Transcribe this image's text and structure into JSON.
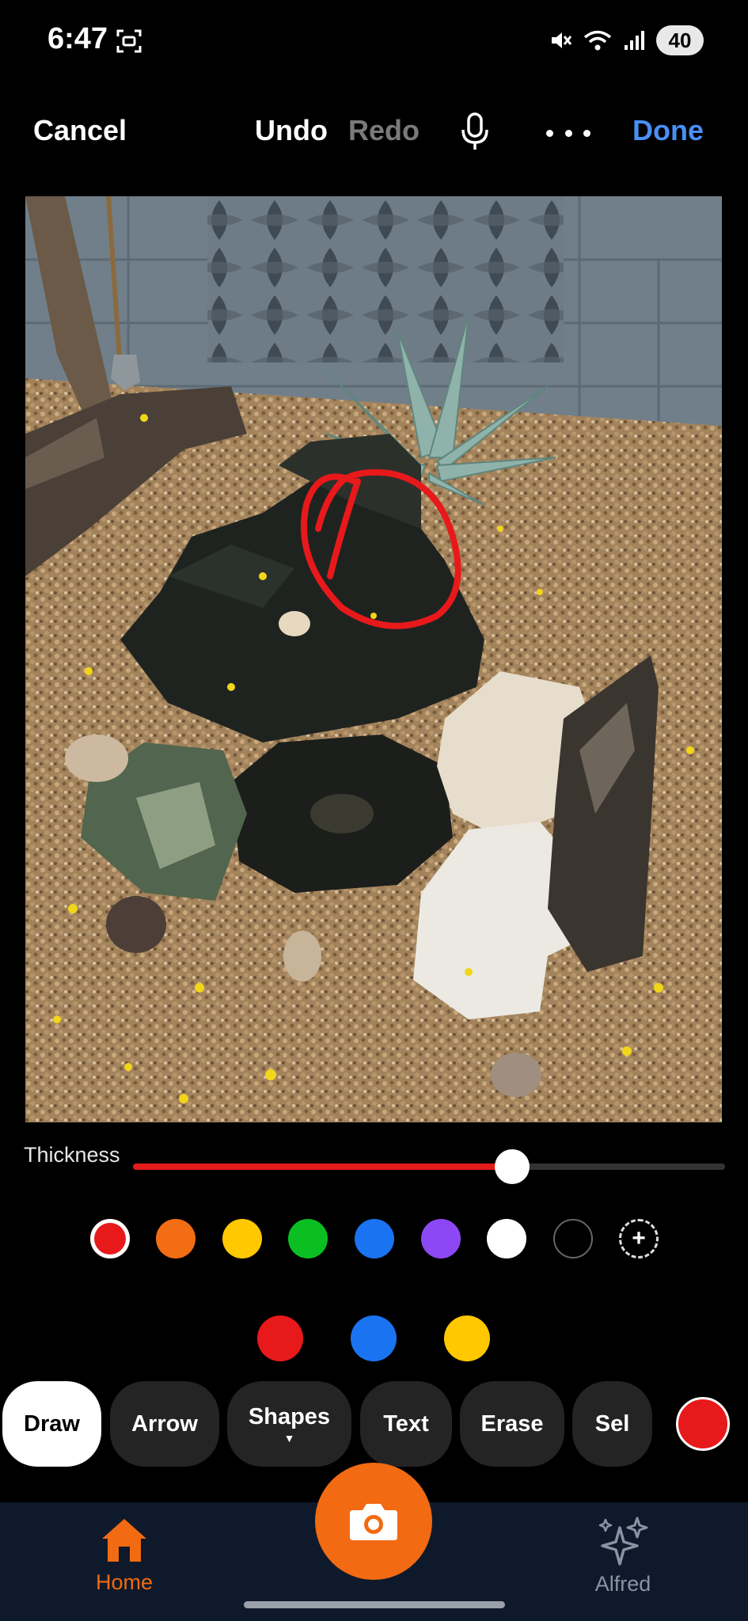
{
  "status_bar": {
    "time": "6:47",
    "battery": "40",
    "icons": [
      "screenshot-icon",
      "mute-icon",
      "wifi-icon",
      "signal-icon"
    ]
  },
  "editor": {
    "cancel_label": "Cancel",
    "undo_label": "Undo",
    "redo_label": "Redo",
    "done_label": "Done",
    "icons": [
      "microphone-icon",
      "more-icon"
    ]
  },
  "thickness": {
    "label": "Thickness",
    "value_fraction": 0.64,
    "color": "#e31b1b"
  },
  "palette": {
    "colors": [
      "#e8191b",
      "#f26d13",
      "#ffc800",
      "#0bbf22",
      "#1a73f0",
      "#8d48f5",
      "#ffffff",
      "#000000"
    ],
    "selected_index": 0,
    "add_label": "+"
  },
  "recent_colors": [
    "#e8191b",
    "#1a73f0",
    "#ffc800"
  ],
  "tools": {
    "items": [
      {
        "label": "Draw",
        "active": true
      },
      {
        "label": "Arrow",
        "active": false
      },
      {
        "label": "Shapes",
        "active": false,
        "has_dropdown": true
      },
      {
        "label": "Text",
        "active": false
      },
      {
        "label": "Erase",
        "active": false
      },
      {
        "label": "Sel",
        "active": false
      }
    ],
    "current_color": "#e8191b"
  },
  "bottom_nav": {
    "home_label": "Home",
    "alfred_label": "Alfred",
    "active_color": "#f26a12",
    "icons": [
      "home-icon",
      "camera-icon",
      "sparkle-icon"
    ]
  }
}
